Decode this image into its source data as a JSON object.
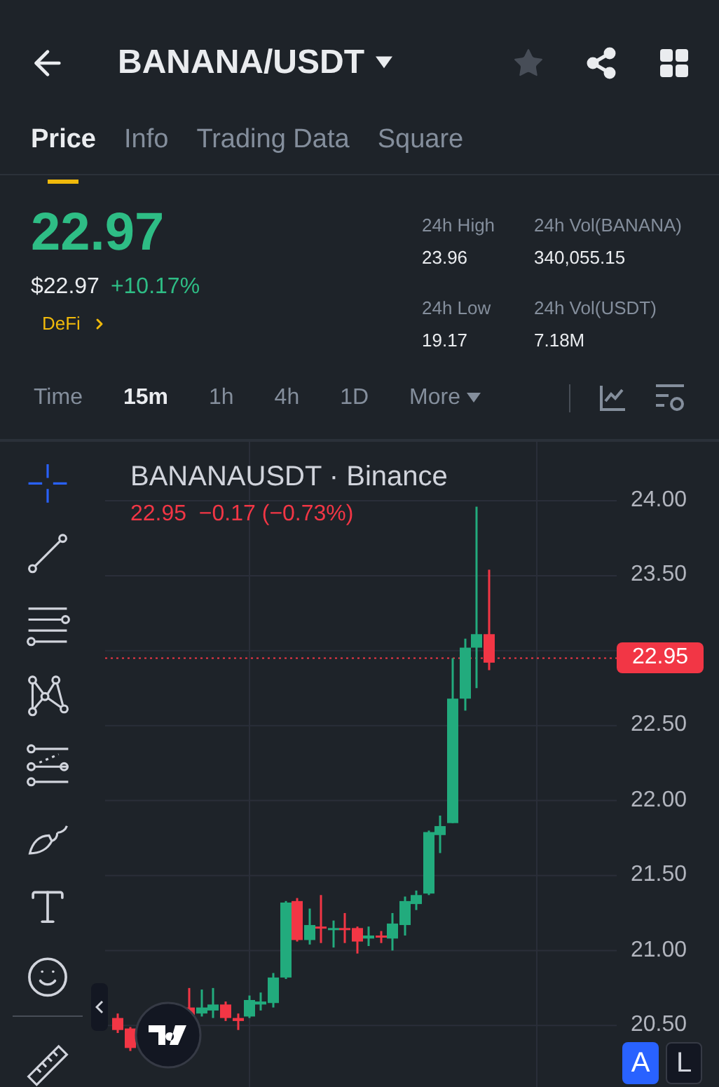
{
  "header": {
    "title": "BANANA/USDT",
    "favorite": false
  },
  "tabs": [
    {
      "label": "Price",
      "selected": true
    },
    {
      "label": "Info",
      "selected": false
    },
    {
      "label": "Trading Data",
      "selected": false
    },
    {
      "label": "Square",
      "selected": false
    }
  ],
  "price": {
    "last": "22.97",
    "usd": "$22.97",
    "change": "+10.17%",
    "tag": "DeFi"
  },
  "stats": [
    {
      "label": "24h High",
      "value": "23.96"
    },
    {
      "label": "24h Vol(BANANA)",
      "value": "340,055.15"
    },
    {
      "label": "24h Low",
      "value": "19.17"
    },
    {
      "label": "24h Vol(USDT)",
      "value": "7.18M"
    }
  ],
  "intervals": [
    {
      "label": "Time",
      "selected": false
    },
    {
      "label": "15m",
      "selected": true
    },
    {
      "label": "1h",
      "selected": false
    },
    {
      "label": "4h",
      "selected": false
    },
    {
      "label": "1D",
      "selected": false
    },
    {
      "label": "More",
      "selected": false
    }
  ],
  "chart": {
    "symbol": "BANANAUSDT · Binance",
    "ohlc": "22.95  −0.17 (−0.73%)",
    "price_labels": [
      "24.00",
      "23.50",
      "22.50",
      "22.00",
      "21.50",
      "21.00",
      "20.50"
    ],
    "last_price": "22.95"
  },
  "scale_buttons": [
    {
      "label": "A",
      "selected": true
    },
    {
      "label": "L",
      "selected": false
    }
  ]
}
